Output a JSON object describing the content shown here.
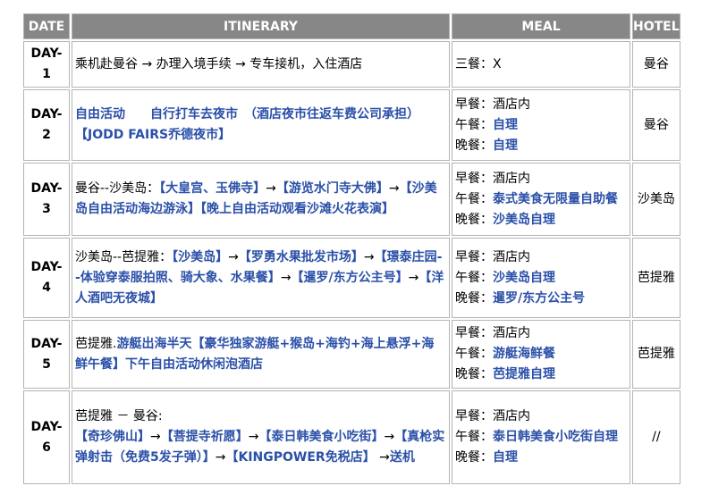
{
  "headers": {
    "date": "DATE",
    "itinerary": "ITINERARY",
    "meal": "MEAL",
    "hotel": "HOTEL"
  },
  "rows": [
    {
      "day": "DAY-1",
      "itinerary": [
        {
          "t": "乘机赴曼谷 ",
          "c": "black"
        },
        {
          "t": "→",
          "c": "black"
        },
        {
          "t": " 办理入境手续 ",
          "c": "black"
        },
        {
          "t": "→",
          "c": "black"
        },
        {
          "t": " 专车接机，入住酒店",
          "c": "black"
        }
      ],
      "meals": [
        {
          "label": "三餐：",
          "value": "X",
          "c": "black"
        }
      ],
      "hotel": "曼谷"
    },
    {
      "day": "DAY-2",
      "itinerary": [
        {
          "t": "自由活动　　自行打车去夜市　（酒店夜市往返车费公司承担）【JODD FAIRS乔德夜市】",
          "c": "blue"
        }
      ],
      "meals": [
        {
          "label": "早餐：",
          "value": "酒店内",
          "c": "black"
        },
        {
          "label": "午餐：",
          "value": "自理",
          "c": "blue"
        },
        {
          "label": "晚餐：",
          "value": "自理",
          "c": "blue"
        }
      ],
      "hotel": "曼谷"
    },
    {
      "day": "DAY-3",
      "itinerary": [
        {
          "t": "曼谷--沙美岛：",
          "c": "black"
        },
        {
          "t": "【大皇宫、玉佛寺】",
          "c": "blue"
        },
        {
          "t": "→",
          "c": "black"
        },
        {
          "t": "【游览水门寺大佛】",
          "c": "blue"
        },
        {
          "t": "→",
          "c": "black"
        },
        {
          "t": "【沙美岛自由活动海边游泳】【晚上自由活动观看沙滩火花表演】",
          "c": "blue"
        }
      ],
      "meals": [
        {
          "label": "早餐：",
          "value": "酒店内",
          "c": "black"
        },
        {
          "label": "午餐：",
          "value": "泰式美食无限量自助餐",
          "c": "blue"
        },
        {
          "label": "晚餐：",
          "value": "沙美岛自理",
          "c": "blue"
        }
      ],
      "hotel": "沙美岛"
    },
    {
      "day": "DAY-4",
      "itinerary": [
        {
          "t": "沙美岛--芭提雅：",
          "c": "black"
        },
        {
          "t": "【沙美岛】",
          "c": "blue"
        },
        {
          "t": "→",
          "c": "black"
        },
        {
          "t": "【罗勇水果批发市场】",
          "c": "blue"
        },
        {
          "t": "→",
          "c": "black"
        },
        {
          "t": "【璟泰庄园--体验穿泰服拍照、骑大象、水果餐】",
          "c": "blue"
        },
        {
          "t": "→",
          "c": "black"
        },
        {
          "t": "【暹罗/东方公主号】",
          "c": "blue"
        },
        {
          "t": "→",
          "c": "black"
        },
        {
          "t": "【洋人酒吧无夜城】",
          "c": "blue"
        }
      ],
      "meals": [
        {
          "label": "早餐：",
          "value": "酒店内",
          "c": "black"
        },
        {
          "label": "午餐：",
          "value": "沙美岛自理",
          "c": "blue"
        },
        {
          "label": "晚餐：",
          "value": "暹罗/东方公主号",
          "c": "blue"
        }
      ],
      "hotel": "芭提雅"
    },
    {
      "day": "DAY-5",
      "itinerary": [
        {
          "t": "芭提雅.",
          "c": "black"
        },
        {
          "t": "游艇出海半天【豪华独家游艇+猴岛+海钓+海上悬浮+海鲜午餐】下午自由活动休闲泡酒店",
          "c": "blue"
        }
      ],
      "meals": [
        {
          "label": "早餐：",
          "value": "酒店内",
          "c": "black"
        },
        {
          "label": "午餐：",
          "value": "游艇海鲜餐",
          "c": "blue"
        },
        {
          "label": "晚餐：",
          "value": "芭提雅自理",
          "c": "blue"
        }
      ],
      "hotel": "芭提雅"
    },
    {
      "day": "DAY-6",
      "itinerary": [
        {
          "t": "芭提雅 － 曼谷:",
          "c": "black",
          "br": true
        },
        {
          "t": " 【奇珍佛山】",
          "c": "blue"
        },
        {
          "t": "→",
          "c": "black"
        },
        {
          "t": "【菩提寺祈愿】",
          "c": "blue"
        },
        {
          "t": "→",
          "c": "black"
        },
        {
          "t": "【泰日韩美食小吃街】",
          "c": "blue"
        },
        {
          "t": "→",
          "c": "black"
        },
        {
          "t": "【真枪实弹射击（免费5发子弹）】",
          "c": "blue"
        },
        {
          "t": "→",
          "c": "black"
        },
        {
          "t": "【KINGPOWER免税店】",
          "c": "blue"
        },
        {
          "t": " →",
          "c": "black"
        },
        {
          "t": "送机",
          "c": "blue"
        }
      ],
      "meals": [
        {
          "label": "早餐：",
          "value": "酒店内",
          "c": "black"
        },
        {
          "label": "午餐：",
          "value": "泰日韩美食小吃街自理",
          "c": "blue"
        },
        {
          "label": "晚餐：",
          "value": "自理",
          "c": "blue"
        }
      ],
      "hotel": "//"
    }
  ],
  "colors": {
    "header_bg": "#878787",
    "header_text": "#ffffff",
    "link_blue": "#2b50a8",
    "border": "#b4b4b4"
  }
}
